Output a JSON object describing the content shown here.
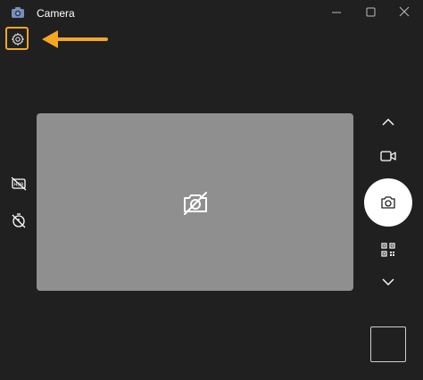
{
  "window": {
    "title": "Camera",
    "icons": [
      "camera-app-icon",
      "minimize-icon",
      "maximize-icon",
      "close-icon"
    ]
  },
  "toolbar": {
    "settings_icon": "gear-icon",
    "highlight_color": "#f5a623"
  },
  "left_controls": [
    "hdr-off-icon",
    "timer-off-icon"
  ],
  "right_controls": [
    "chevron-up-icon",
    "video-mode-icon",
    "photo-shutter-icon",
    "qr-code-icon",
    "chevron-down-icon"
  ],
  "preview": {
    "state_icon": "camera-off-icon",
    "background_color": "#8f8f8f"
  },
  "colors": {
    "window_bg": "#202020",
    "shutter": "#ffffff",
    "annotation_arrow": "#f5a623"
  }
}
